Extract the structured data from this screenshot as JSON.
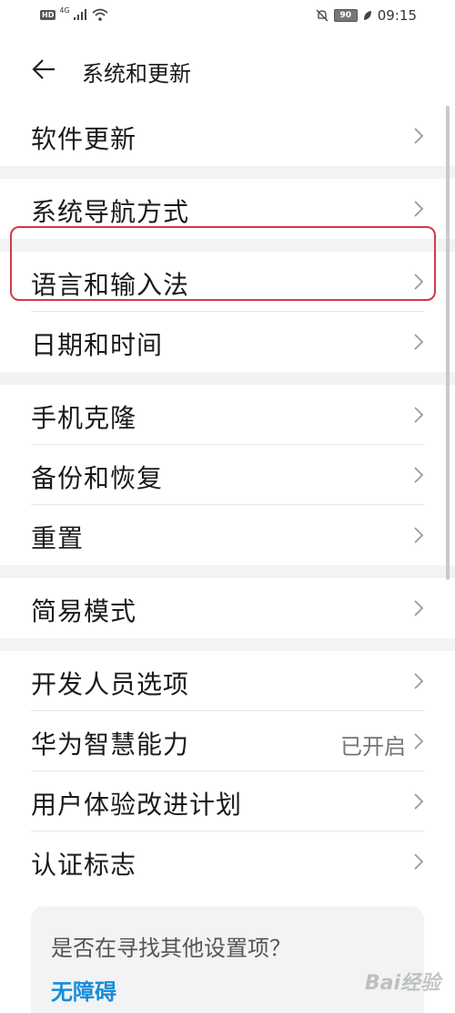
{
  "status_bar": {
    "badge": "HD",
    "network": "4G",
    "battery": "90",
    "time": "09:15"
  },
  "header": {
    "title": "系统和更新"
  },
  "groups": [
    {
      "items": [
        {
          "label": "软件更新",
          "value": ""
        }
      ]
    },
    {
      "items": [
        {
          "label": "系统导航方式",
          "value": ""
        }
      ]
    },
    {
      "items": [
        {
          "label": "语言和输入法",
          "value": ""
        },
        {
          "label": "日期和时间",
          "value": ""
        }
      ]
    },
    {
      "items": [
        {
          "label": "手机克隆",
          "value": ""
        },
        {
          "label": "备份和恢复",
          "value": ""
        },
        {
          "label": "重置",
          "value": ""
        }
      ]
    },
    {
      "items": [
        {
          "label": "简易模式",
          "value": ""
        }
      ]
    },
    {
      "items": [
        {
          "label": "开发人员选项",
          "value": ""
        },
        {
          "label": "华为智慧能力",
          "value": "已开启"
        },
        {
          "label": "用户体验改进计划",
          "value": ""
        },
        {
          "label": "认证标志",
          "value": ""
        }
      ]
    }
  ],
  "suggestion_card": {
    "title": "是否在寻找其他设置项？",
    "link": "无障碍"
  },
  "watermark": "Bai经验",
  "colors": {
    "accent": "#1a8cd8",
    "highlight_border": "#d23a4a",
    "group_gap": "#f1f3f5"
  }
}
